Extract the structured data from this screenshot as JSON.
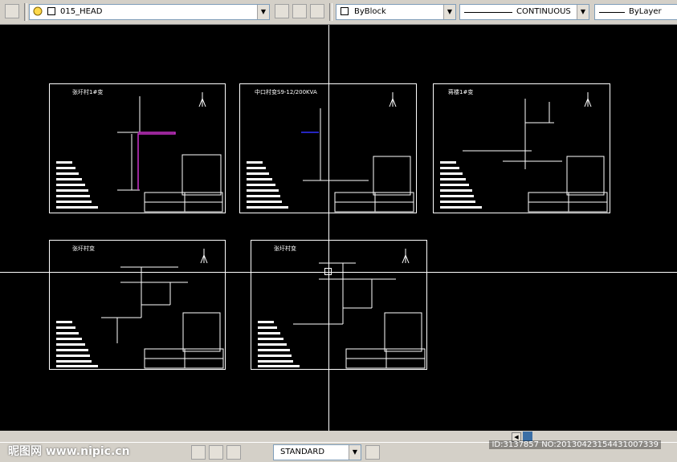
{
  "toolbar": {
    "layer_name": "015_HEAD",
    "color_value": "ByBlock",
    "linetype_value": "CONTINUOUS",
    "lineweight_value": "ByLayer"
  },
  "sheets": [
    {
      "title": "张圩村1#变"
    },
    {
      "title": "中口村变S9-12/200KVA"
    },
    {
      "title": "蒋楼1#变"
    },
    {
      "title": "张圩村变"
    },
    {
      "title": "张圩村变"
    }
  ],
  "statusbar": {
    "textstyle_value": "STANDARD",
    "watermark": "昵图网 www.nipic.cn",
    "image_id": "ID:3137857 NO:20130423154431007339"
  },
  "colors": {
    "canvas": "#000000",
    "linework": "#ffffff",
    "magenta_line": "#cc33cc",
    "blue_line": "#3333ff"
  }
}
